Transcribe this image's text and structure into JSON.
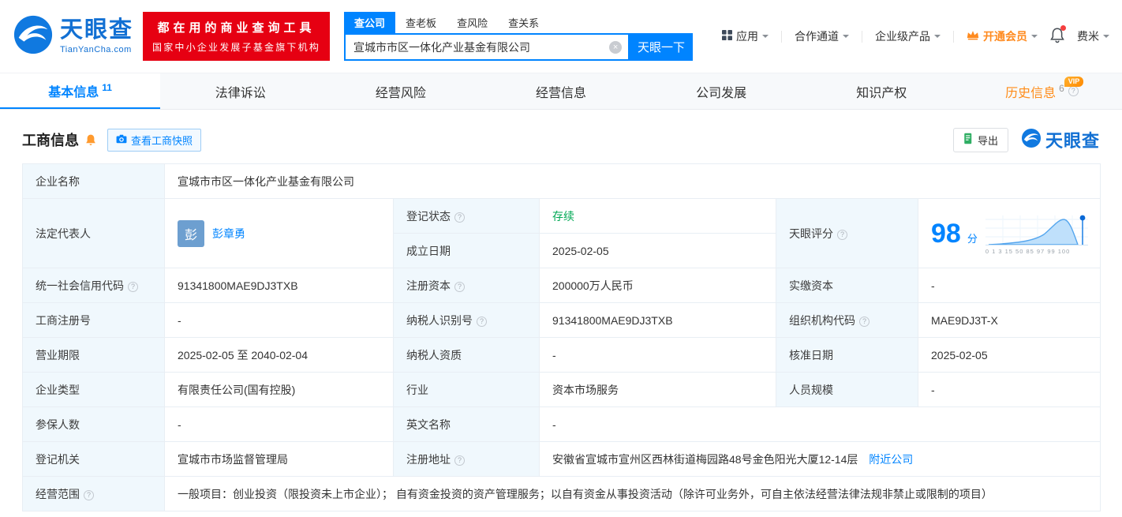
{
  "colors": {
    "accent_blue": "#0084ff",
    "brand_red": "#e60012",
    "status_green": "#00a854",
    "vip_orange": "#ff8a1e",
    "history_tab_orange": "#ff8c19",
    "label_cell_bg": "#f0f8fd"
  },
  "icons": {
    "help": "?",
    "clear": "×"
  },
  "header": {
    "logo": {
      "name": "天眼查",
      "domain": "TianYanCha.com"
    },
    "badge": {
      "line1": "都在用的商业查询工具",
      "line2": "国家中小企业发展子基金旗下机构"
    },
    "search": {
      "tabs": [
        {
          "label": "查公司"
        },
        {
          "label": "查老板"
        },
        {
          "label": "查风险"
        },
        {
          "label": "查关系"
        }
      ],
      "value": "宣城市市区一体化产业基金有限公司",
      "button": "天眼一下"
    },
    "nav": {
      "apps": "应用",
      "cooperation": "合作通道",
      "enterprise": "企业级产品",
      "vip": "开通会员",
      "user": "费米"
    }
  },
  "tabs": [
    {
      "label": "基本信息",
      "count": "11"
    },
    {
      "label": "法律诉讼",
      "count": ""
    },
    {
      "label": "经营风险",
      "count": ""
    },
    {
      "label": "经营信息",
      "count": ""
    },
    {
      "label": "公司发展",
      "count": ""
    },
    {
      "label": "知识产权",
      "count": ""
    },
    {
      "label": "历史信息",
      "count": "6",
      "vip": "VIP"
    }
  ],
  "section": {
    "title": "工商信息",
    "snapshot": "查看工商快照",
    "export": "导出",
    "brand": "天眼查"
  },
  "info": {
    "company_name": {
      "label": "企业名称",
      "value": "宣城市市区一体化产业基金有限公司"
    },
    "legal_rep": {
      "label": "法定代表人",
      "avatar": "彭",
      "value": "彭章勇"
    },
    "reg_status": {
      "label": "登记状态",
      "value": "存续"
    },
    "establish_date": {
      "label": "成立日期",
      "value": "2025-02-05"
    },
    "score": {
      "label": "天眼评分",
      "value": "98",
      "unit": "分",
      "axis": "0 1 3 15 50 85 97 99 100"
    },
    "credit_code": {
      "label": "统一社会信用代码",
      "value": "91341800MAE9DJ3TXB"
    },
    "reg_capital": {
      "label": "注册资本",
      "value": "200000万人民币"
    },
    "paid_capital": {
      "label": "实缴资本",
      "value": "-"
    },
    "reg_number": {
      "label": "工商注册号",
      "value": "-"
    },
    "taxpayer_id": {
      "label": "纳税人识别号",
      "value": "91341800MAE9DJ3TXB"
    },
    "org_code": {
      "label": "组织机构代码",
      "value": "MAE9DJ3T-X"
    },
    "business_term": {
      "label": "营业期限",
      "value": "2025-02-05 至 2040-02-04"
    },
    "taxpayer_quality": {
      "label": "纳税人资质",
      "value": "-"
    },
    "approval_date": {
      "label": "核准日期",
      "value": "2025-02-05"
    },
    "company_type": {
      "label": "企业类型",
      "value": "有限责任公司(国有控股)"
    },
    "industry": {
      "label": "行业",
      "value": "资本市场服务"
    },
    "staff_size": {
      "label": "人员规模",
      "value": "-"
    },
    "insured_count": {
      "label": "参保人数",
      "value": "-"
    },
    "english_name": {
      "label": "英文名称",
      "value": "-"
    },
    "reg_authority": {
      "label": "登记机关",
      "value": "宣城市市场监督管理局"
    },
    "reg_address": {
      "label": "注册地址",
      "value": "安徽省宣城市宣州区西林街道梅园路48号金色阳光大厦12-14层",
      "link": "附近公司"
    },
    "business_scope": {
      "label": "经营范围",
      "value": "一般项目：创业投资（限投资未上市企业）； 自有资金投资的资产管理服务；以自有资金从事投资活动（除许可业务外，可自主依法经营法律法规非禁止或限制的项目）"
    }
  }
}
